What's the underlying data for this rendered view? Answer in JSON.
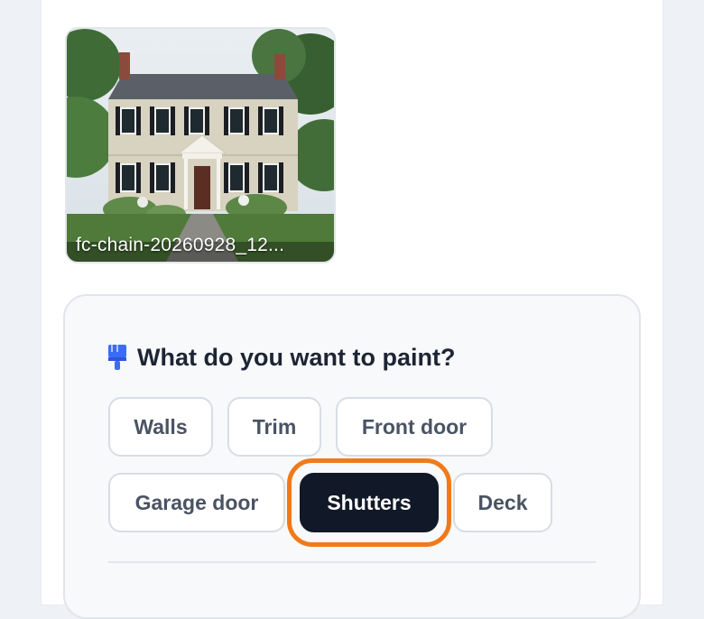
{
  "upload": {
    "filename": "fc-chain-20260928_12..."
  },
  "paint_section": {
    "title": "What do you want to paint?",
    "icon": "paint-brush-icon",
    "options": [
      {
        "label": "Walls",
        "selected": false
      },
      {
        "label": "Trim",
        "selected": false
      },
      {
        "label": "Front door",
        "selected": false
      },
      {
        "label": "Garage door",
        "selected": false
      },
      {
        "label": "Shutters",
        "selected": true
      },
      {
        "label": "Deck",
        "selected": false
      }
    ]
  },
  "colors": {
    "accent_highlight": "#f07a1a",
    "selected_chip": "#111827",
    "icon_blue": "#3b6cf5"
  }
}
